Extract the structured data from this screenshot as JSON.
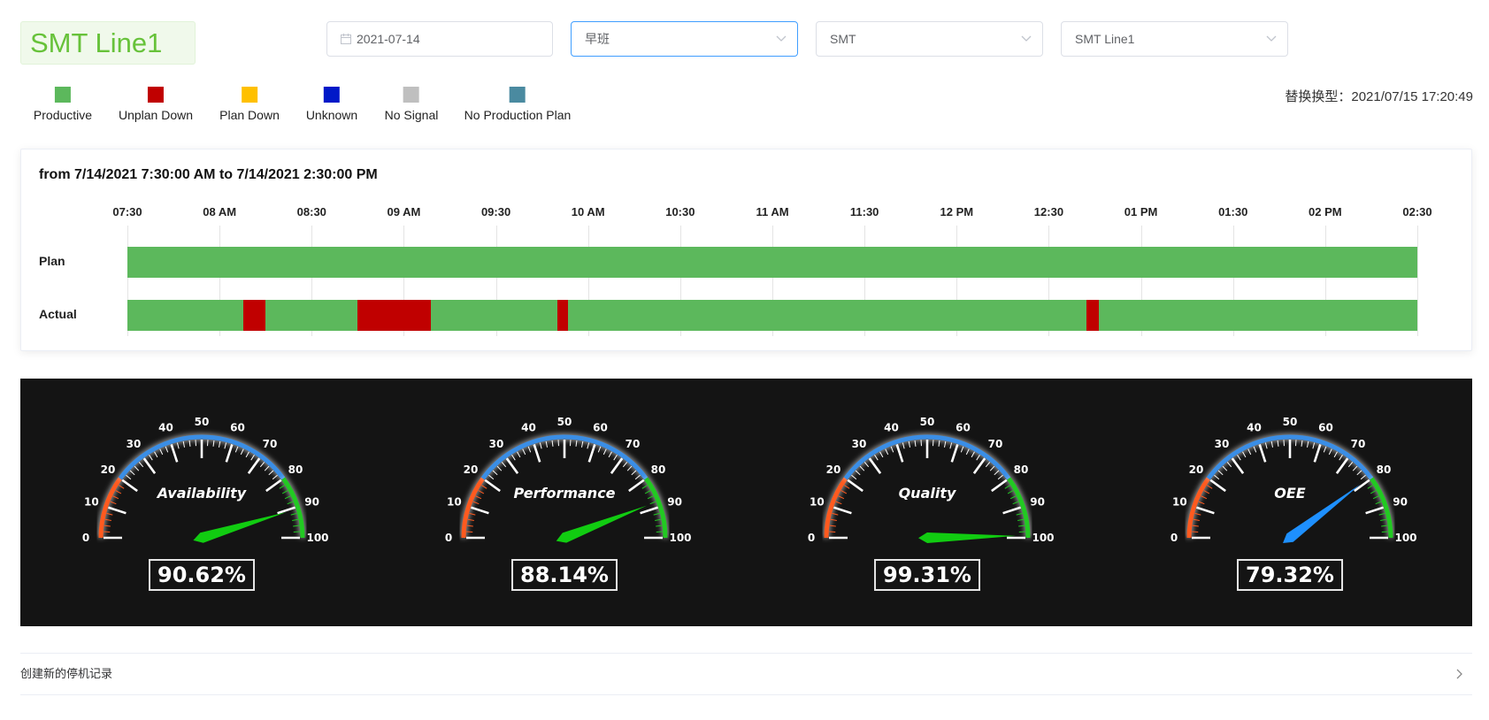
{
  "header": {
    "line_title": "SMT Line1",
    "date": {
      "value": "2021-07-14"
    },
    "shift": {
      "value": "早班"
    },
    "area": {
      "value": "SMT"
    },
    "line": {
      "value": "SMT Line1"
    }
  },
  "legend": [
    {
      "label": "Productive",
      "color": "#5cb85c"
    },
    {
      "label": "Unplan Down",
      "color": "#c00000"
    },
    {
      "label": "Plan Down",
      "color": "#ffc000"
    },
    {
      "label": "Unknown",
      "color": "#0019c8"
    },
    {
      "label": "No Signal",
      "color": "#bfbfbf"
    },
    {
      "label": "No Production Plan",
      "color": "#4a8aa0"
    }
  ],
  "replace_text": "替换换型：2021/07/15 17:20:49",
  "chart_data": {
    "type": "timeline",
    "title": "from 7/14/2021 7:30:00 AM to 7/14/2021 2:30:00 PM",
    "ticks": [
      "07:30",
      "08 AM",
      "08:30",
      "09 AM",
      "09:30",
      "10 AM",
      "10:30",
      "11 AM",
      "11:30",
      "12 PM",
      "12:30",
      "01 PM",
      "01:30",
      "02 PM",
      "02:30"
    ],
    "range_minutes": [
      0,
      420
    ],
    "rows": [
      {
        "label": "Plan",
        "segments": [
          {
            "status": "Productive",
            "start": 0,
            "end": 420
          }
        ]
      },
      {
        "label": "Actual",
        "segments": [
          {
            "status": "Productive",
            "start": 0,
            "end": 37.6
          },
          {
            "status": "Unplan Down",
            "start": 37.6,
            "end": 44.8
          },
          {
            "status": "Productive",
            "start": 44.8,
            "end": 74.9
          },
          {
            "status": "Unplan Down",
            "start": 74.9,
            "end": 98.8
          },
          {
            "status": "Productive",
            "start": 98.8,
            "end": 139.9
          },
          {
            "status": "Unplan Down",
            "start": 139.9,
            "end": 143.6
          },
          {
            "status": "Productive",
            "start": 143.6,
            "end": 312.4
          },
          {
            "status": "Unplan Down",
            "start": 312.4,
            "end": 316.4
          },
          {
            "status": "Productive",
            "start": 316.4,
            "end": 420
          }
        ]
      }
    ]
  },
  "gauges": [
    {
      "name": "Availability",
      "value": 90.62,
      "display": "90.62%",
      "needle_color": "#11cc11"
    },
    {
      "name": "Performance",
      "value": 88.14,
      "display": "88.14%",
      "needle_color": "#11cc11"
    },
    {
      "name": "Quality",
      "value": 99.31,
      "display": "99.31%",
      "needle_color": "#11cc11"
    },
    {
      "name": "OEE",
      "value": 79.32,
      "display": "79.32%",
      "needle_color": "#1e90ff"
    }
  ],
  "gauge_scale": [
    "0",
    "10",
    "20",
    "30",
    "40",
    "50",
    "60",
    "70",
    "80",
    "90",
    "100"
  ],
  "footer": {
    "label": "创建新的停机记录"
  }
}
